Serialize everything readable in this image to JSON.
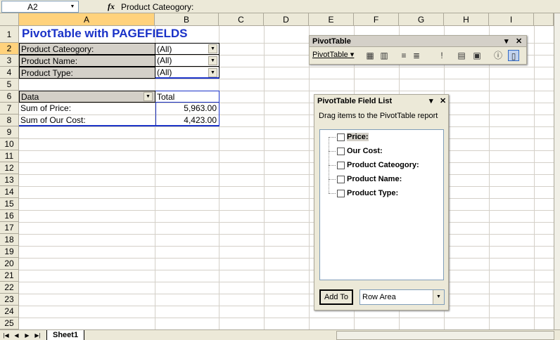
{
  "formula_bar": {
    "name_box": "A2",
    "fx_symbol": "fx",
    "formula": "Product Cateogory:"
  },
  "columns": [
    "A",
    "B",
    "C",
    "D",
    "E",
    "F",
    "G",
    "H",
    "I"
  ],
  "rows": [
    "1",
    "2",
    "3",
    "4",
    "5",
    "6",
    "7",
    "8",
    "9",
    "10",
    "11",
    "12",
    "13",
    "14",
    "15",
    "16",
    "17",
    "18",
    "19",
    "20",
    "21",
    "22",
    "23",
    "24",
    "25"
  ],
  "sheet": {
    "title": "PivotTable with PAGEFIELDS",
    "page_fields": [
      {
        "label": "Product Cateogory:",
        "value": "(All)"
      },
      {
        "label": "Product Name:",
        "value": "(All)"
      },
      {
        "label": "Product Type:",
        "value": "(All)"
      }
    ],
    "data_header": "Data",
    "total_header": "Total",
    "data_rows": [
      {
        "label": "Sum of Price:",
        "value": "5,963.00"
      },
      {
        "label": "Sum of Our Cost:",
        "value": "4,423.00"
      }
    ]
  },
  "tabs": {
    "sheet1": "Sheet1"
  },
  "pivot_toolbar": {
    "title": "PivotTable",
    "menu_label": "PivotTable ▾",
    "close": "✕",
    "dropdown": "▾"
  },
  "field_list": {
    "title": "PivotTable Field List",
    "hint": "Drag items to the PivotTable report",
    "fields": [
      "Price:",
      "Our Cost:",
      "Product Cateogory:",
      "Product Name:",
      "Product Type:"
    ],
    "add_to_label": "Add To",
    "area_value": "Row Area",
    "close": "✕",
    "dropdown": "▾"
  },
  "icons": {
    "dropdown_arrow": "▼",
    "nav_first": "|◀",
    "nav_prev": "◀",
    "nav_next": "▶",
    "nav_last": "▶|"
  }
}
